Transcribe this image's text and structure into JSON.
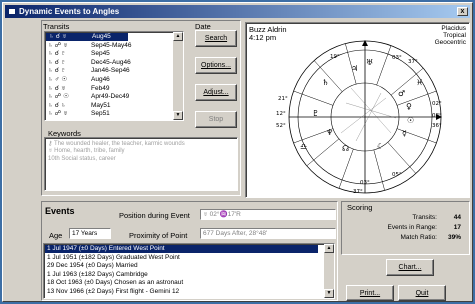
{
  "window": {
    "title": "Dynamic Events to Angles",
    "close": "x"
  },
  "transits": {
    "header_transits": "Transits",
    "header_date": "Date",
    "rows": [
      {
        "glyphs": "♄ ☌ ♅",
        "date": "Aug45",
        "selected": true
      },
      {
        "glyphs": "♄ ☍ ♅",
        "date": "Sep45-May46"
      },
      {
        "glyphs": "♄ ☌ ♇",
        "date": "Sep45"
      },
      {
        "glyphs": "♄ ☌ ♇",
        "date": "Dec45-Aug46"
      },
      {
        "glyphs": "♄ ☌ ♇",
        "date": "Jan46-Sep46"
      },
      {
        "glyphs": "♄ ♂ ☉",
        "date": "Aug46"
      },
      {
        "glyphs": "♄ ☌ ♅",
        "date": "Feb49"
      },
      {
        "glyphs": "♄ ☍ ☉",
        "date": "Apr49-Dec49"
      },
      {
        "glyphs": "♄ ☌ ♄",
        "date": "May51"
      },
      {
        "glyphs": "♄ ☍ ♅",
        "date": "Sep51"
      }
    ]
  },
  "buttons": {
    "search": "Search",
    "options": "Options...",
    "adjust": "Adjust...",
    "stop": "Stop",
    "chart": "Chart...",
    "print": "Print...",
    "quit": "Quit"
  },
  "keywords": {
    "label": "Keywords",
    "lines": [
      "⚷ The wounded healer, the teacher, karmic wounds",
      "♅ Home, hearth, tribe, family",
      "10th Social status, career"
    ]
  },
  "chart": {
    "name": "Buzz Aldrin",
    "time": "4:12 pm",
    "system_lines": [
      "Placidus",
      "Tropical",
      "Geocentric"
    ]
  },
  "events": {
    "label": "Events",
    "position_label": "Position during Event",
    "position_value": "♅ 02°♒17'R",
    "age_label": "Age",
    "age_value": "17 Years",
    "proximity_label": "Proximity of Point",
    "proximity_value": "677 Days After, 28°48'",
    "rows": [
      {
        "text": "1 Jul 1947 (±0 Days) Entered West Point",
        "selected": true
      },
      {
        "text": "1 Jul 1951 (±182 Days) Graduated West Point"
      },
      {
        "text": "29 Dec 1954 (±0 Days) Married"
      },
      {
        "text": "1 Jul 1963 (±182 Days) Cambridge"
      },
      {
        "text": "18 Oct 1963 (±0 Days) Chosen as an astronaut"
      },
      {
        "text": "13 Nov 1966 (±2 Days) First flight - Gemini 12"
      }
    ]
  },
  "scoring": {
    "label": "Scoring",
    "transits_label": "Transits:",
    "transits_value": "44",
    "range_label": "Events in Range:",
    "range_value": "17",
    "ratio_label": "Match Ratio:",
    "ratio_value": "39%"
  }
}
